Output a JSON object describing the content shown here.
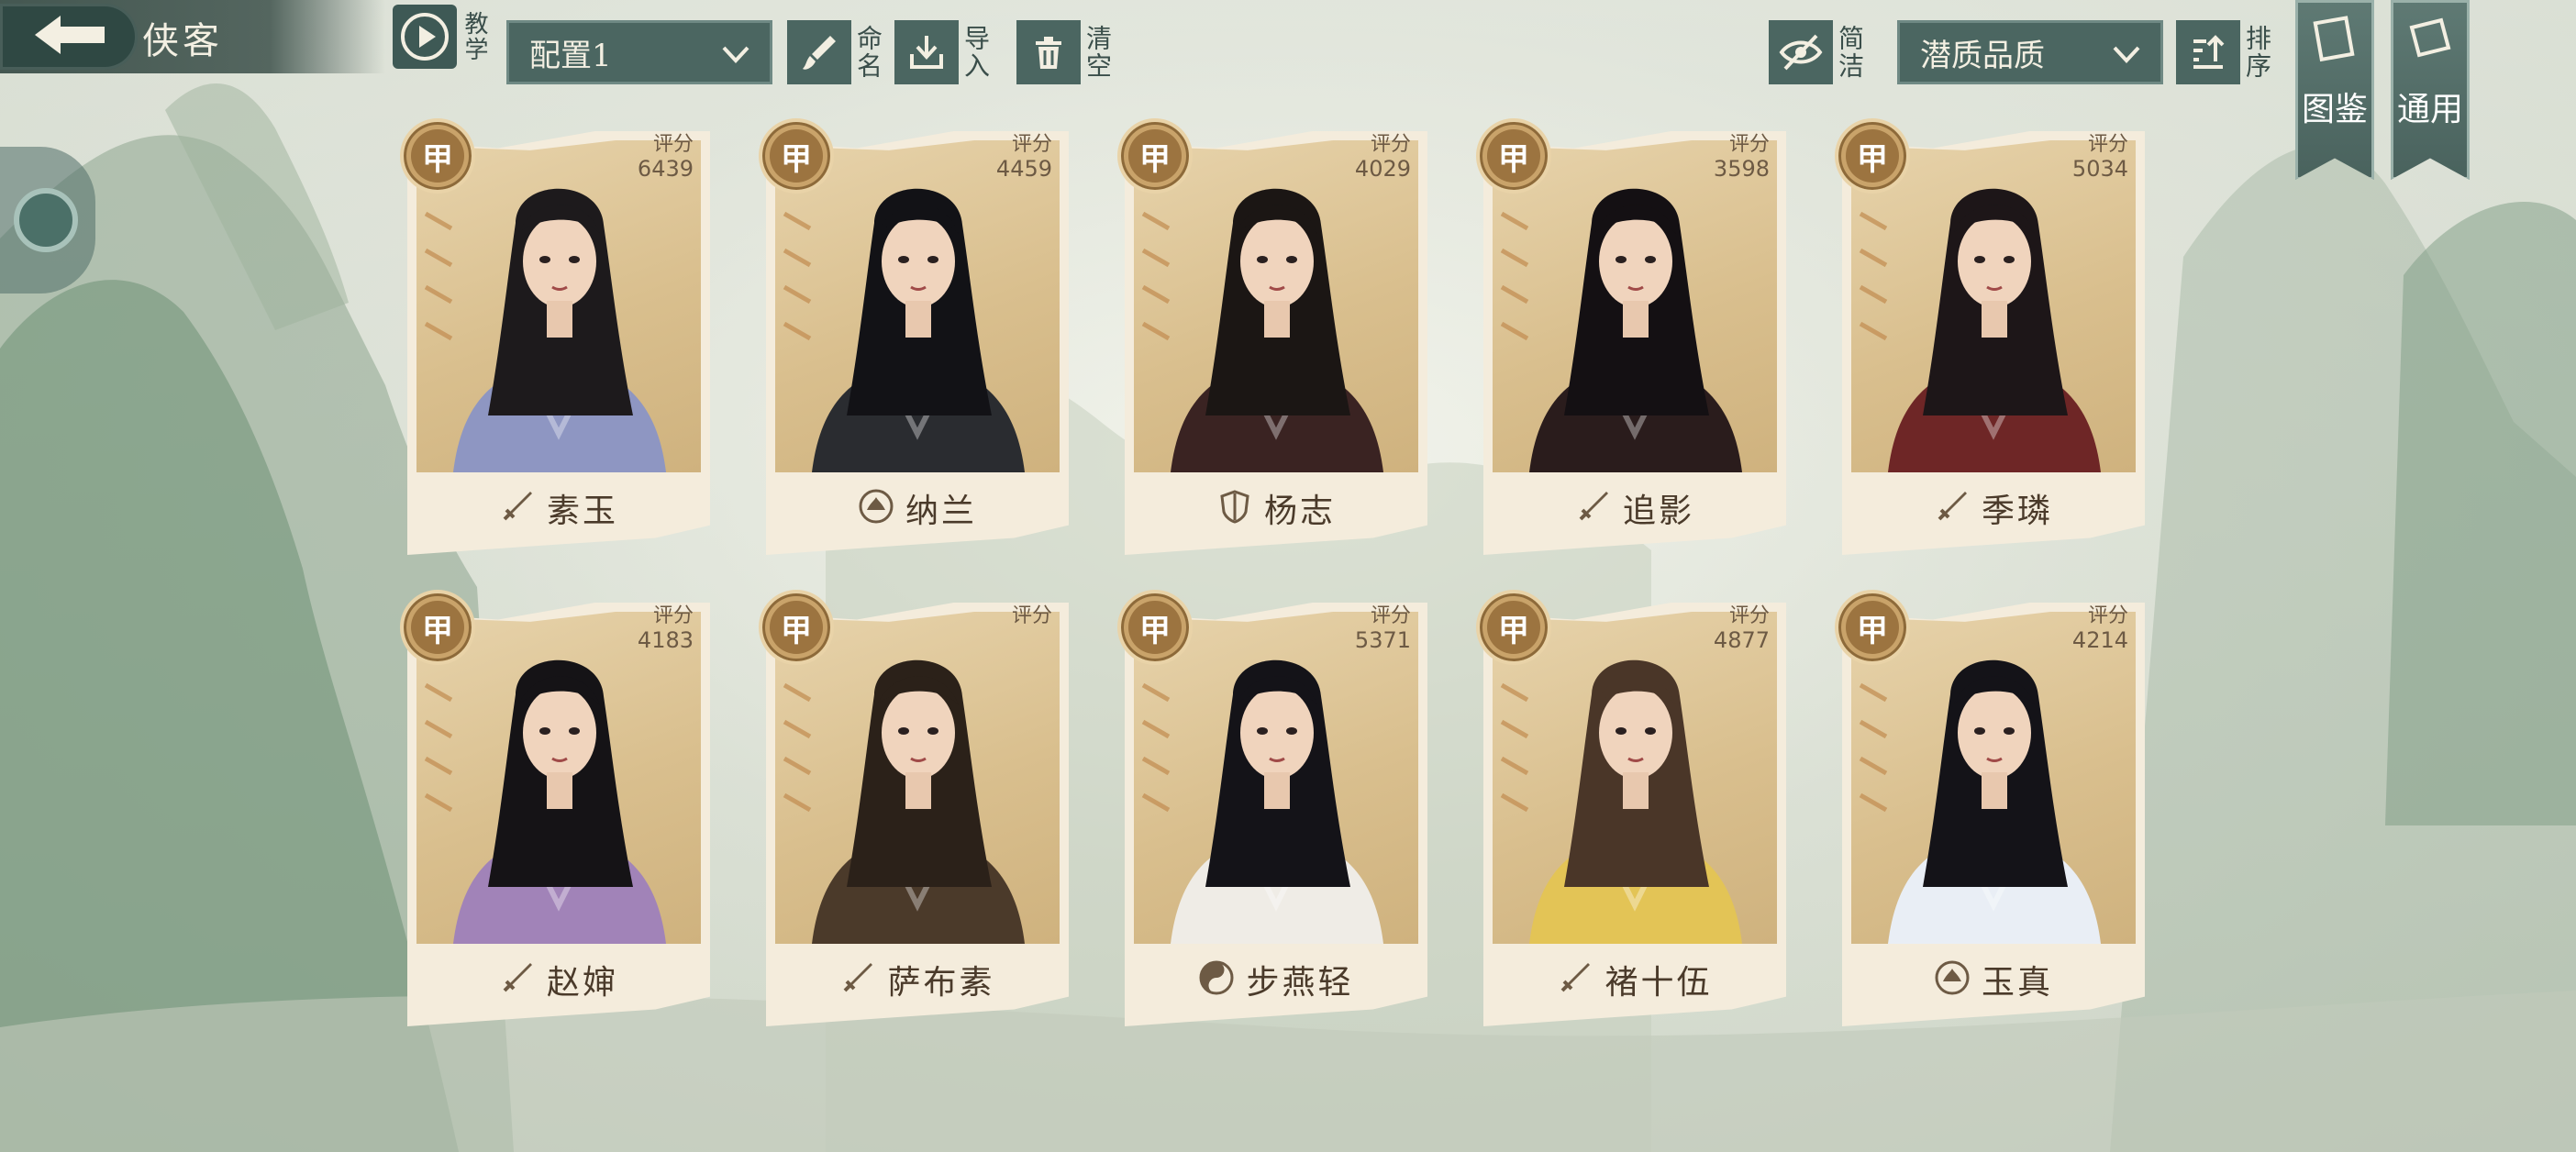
{
  "header": {
    "title": "侠客",
    "tutorial_label": "教学",
    "config_value": "配置1",
    "rename_label": "命名",
    "import_label": "导入",
    "clear_label": "清空",
    "simple_label": "简洁",
    "sort_filter_value": "潜质品质",
    "sort_label": "排序",
    "codex_label": "图鉴",
    "general_label": "通用"
  },
  "colors": {
    "bar": "#4b6661",
    "card": "#f4ecdc",
    "grade": "#9c7440"
  },
  "score_label": "评分",
  "heroes": [
    {
      "name": "素玉",
      "grade": "甲",
      "score": "6439",
      "icon": "sword-icon",
      "robe": "#8e96c2",
      "hair": "#1d1a1c"
    },
    {
      "name": "纳兰",
      "grade": "甲",
      "score": "4459",
      "icon": "lotus-icon",
      "robe": "#2a2c30",
      "hair": "#121216"
    },
    {
      "name": "杨志",
      "grade": "甲",
      "score": "4029",
      "icon": "shield-icon",
      "robe": "#3a2322",
      "hair": "#1b1614"
    },
    {
      "name": "追影",
      "grade": "甲",
      "score": "3598",
      "icon": "sword-icon",
      "robe": "#2a1c1c",
      "hair": "#141013"
    },
    {
      "name": "季璘",
      "grade": "甲",
      "score": "5034",
      "icon": "sword-icon",
      "robe": "#6e2626",
      "hair": "#1d1618"
    },
    {
      "name": "赵婶",
      "grade": "甲",
      "score": "4183",
      "icon": "sword-icon",
      "robe": "#a183b8",
      "hair": "#151316"
    },
    {
      "name": "萨布素",
      "grade": "甲",
      "score": "",
      "icon": "sword-icon",
      "robe": "#4b3a2a",
      "hair": "#2b2119"
    },
    {
      "name": "步燕轻",
      "grade": "甲",
      "score": "5371",
      "icon": "yinyang-icon",
      "robe": "#efece6",
      "hair": "#141318"
    },
    {
      "name": "褚十伍",
      "grade": "甲",
      "score": "4877",
      "icon": "sword-icon",
      "robe": "#e3c456",
      "hair": "#4a3628"
    },
    {
      "name": "玉真",
      "grade": "甲",
      "score": "4214",
      "icon": "lotus-icon",
      "robe": "#e9eef5",
      "hair": "#141318"
    }
  ]
}
